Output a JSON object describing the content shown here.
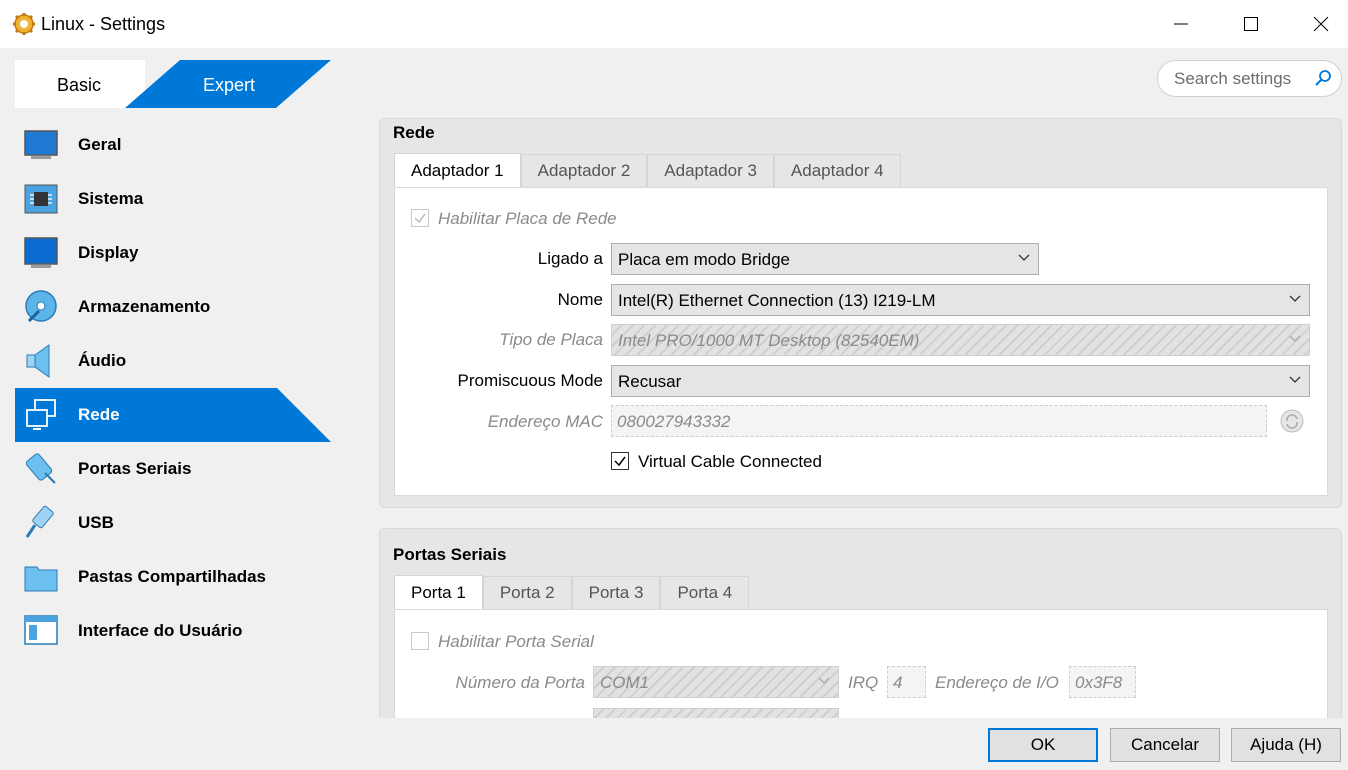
{
  "window": {
    "title": "Linux - Settings"
  },
  "mode": {
    "basic_label": "Basic",
    "expert_label": "Expert"
  },
  "search": {
    "placeholder": "Search settings"
  },
  "sidebar": {
    "items": [
      {
        "label": "Geral",
        "icon": "general-icon"
      },
      {
        "label": "Sistema",
        "icon": "chip-icon"
      },
      {
        "label": "Display",
        "icon": "monitor-icon"
      },
      {
        "label": "Armazenamento",
        "icon": "disk-icon"
      },
      {
        "label": "Áudio",
        "icon": "speaker-icon"
      },
      {
        "label": "Rede",
        "icon": "network-icon",
        "active": true
      },
      {
        "label": "Portas Seriais",
        "icon": "serial-icon"
      },
      {
        "label": "USB",
        "icon": "usb-icon"
      },
      {
        "label": "Pastas Compartilhadas",
        "icon": "folder-icon"
      },
      {
        "label": "Interface do Usuário",
        "icon": "window-icon"
      }
    ]
  },
  "network": {
    "title": "Rede",
    "tabs": [
      "Adaptador 1",
      "Adaptador 2",
      "Adaptador 3",
      "Adaptador 4"
    ],
    "enable_label": "Habilitar Placa de Rede",
    "attached_label": "Ligado a",
    "attached_value": "Placa em modo Bridge",
    "name_label": "Nome",
    "name_value": "Intel(R) Ethernet Connection (13) I219-LM",
    "adapter_type_label": "Tipo de Placa",
    "adapter_type_value": "Intel PRO/1000 MT Desktop (82540EM)",
    "promisc_label": "Promiscuous Mode",
    "promisc_value": "Recusar",
    "mac_label": "Endereço MAC",
    "mac_value": "080027943332",
    "cable_label": "Virtual Cable Connected"
  },
  "serial": {
    "title": "Portas Seriais",
    "tabs": [
      "Porta 1",
      "Porta 2",
      "Porta 3",
      "Porta 4"
    ],
    "enable_label": "Habilitar Porta Serial",
    "port_number_label": "Número da Porta",
    "port_number_value": "COM1",
    "irq_label": "IRQ",
    "irq_value": "4",
    "io_label": "Endereço de I/O",
    "io_value": "0x3F8"
  },
  "buttons": {
    "ok": "OK",
    "cancel": "Cancelar",
    "help": "Ajuda (H)"
  },
  "colors": {
    "accent": "#0078d7",
    "window_bg": "#f0f0f0"
  }
}
